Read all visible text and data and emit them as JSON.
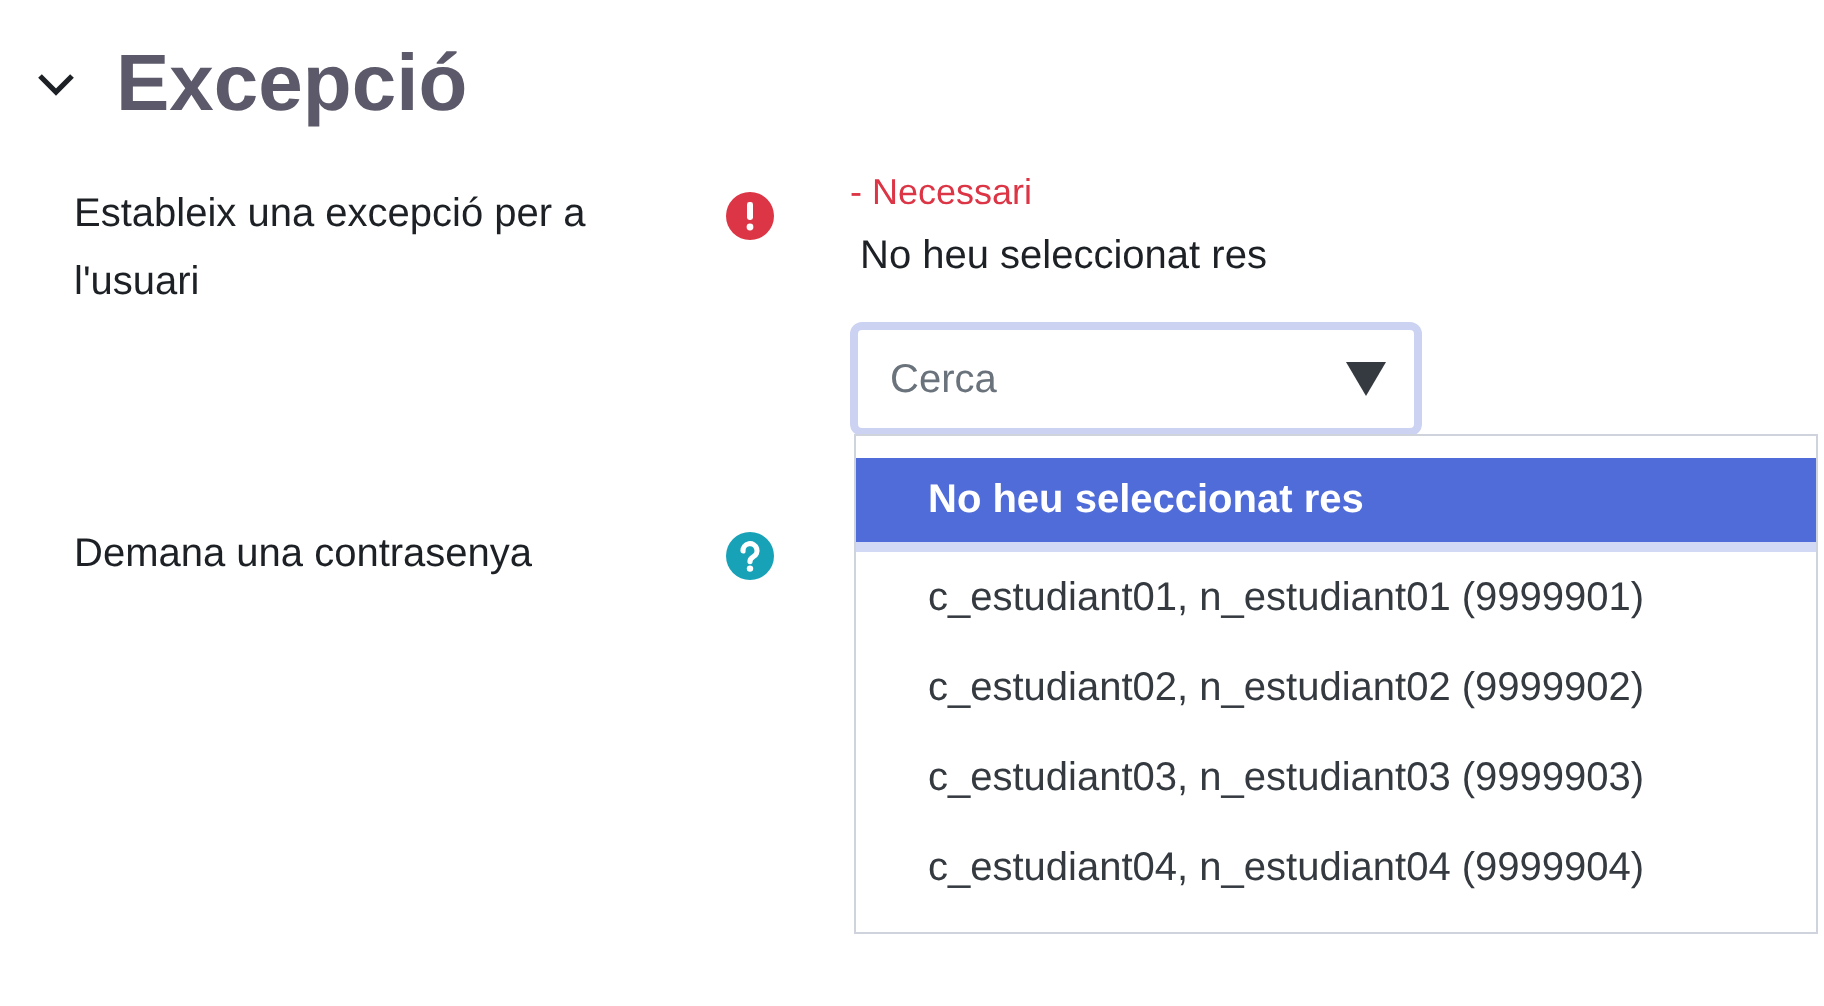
{
  "section": {
    "title": "Excepció",
    "expanded": true
  },
  "fields": [
    {
      "label": "Estableix una excepció per a l'usuari",
      "kind": "required",
      "required_note": "- Necessari",
      "value": "No heu seleccionat res",
      "search": {
        "placeholder": "Cerca"
      },
      "options": [
        {
          "label": "No heu seleccionat res",
          "selected": true
        },
        {
          "label": "c_estudiant01, n_estudiant01 (9999901)",
          "selected": false
        },
        {
          "label": "c_estudiant02, n_estudiant02 (9999902)",
          "selected": false
        },
        {
          "label": "c_estudiant03, n_estudiant03 (9999903)",
          "selected": false
        },
        {
          "label": "c_estudiant04, n_estudiant04 (9999904)",
          "selected": false
        }
      ]
    },
    {
      "label": "Demana una contrasenya",
      "kind": "help"
    }
  ]
}
